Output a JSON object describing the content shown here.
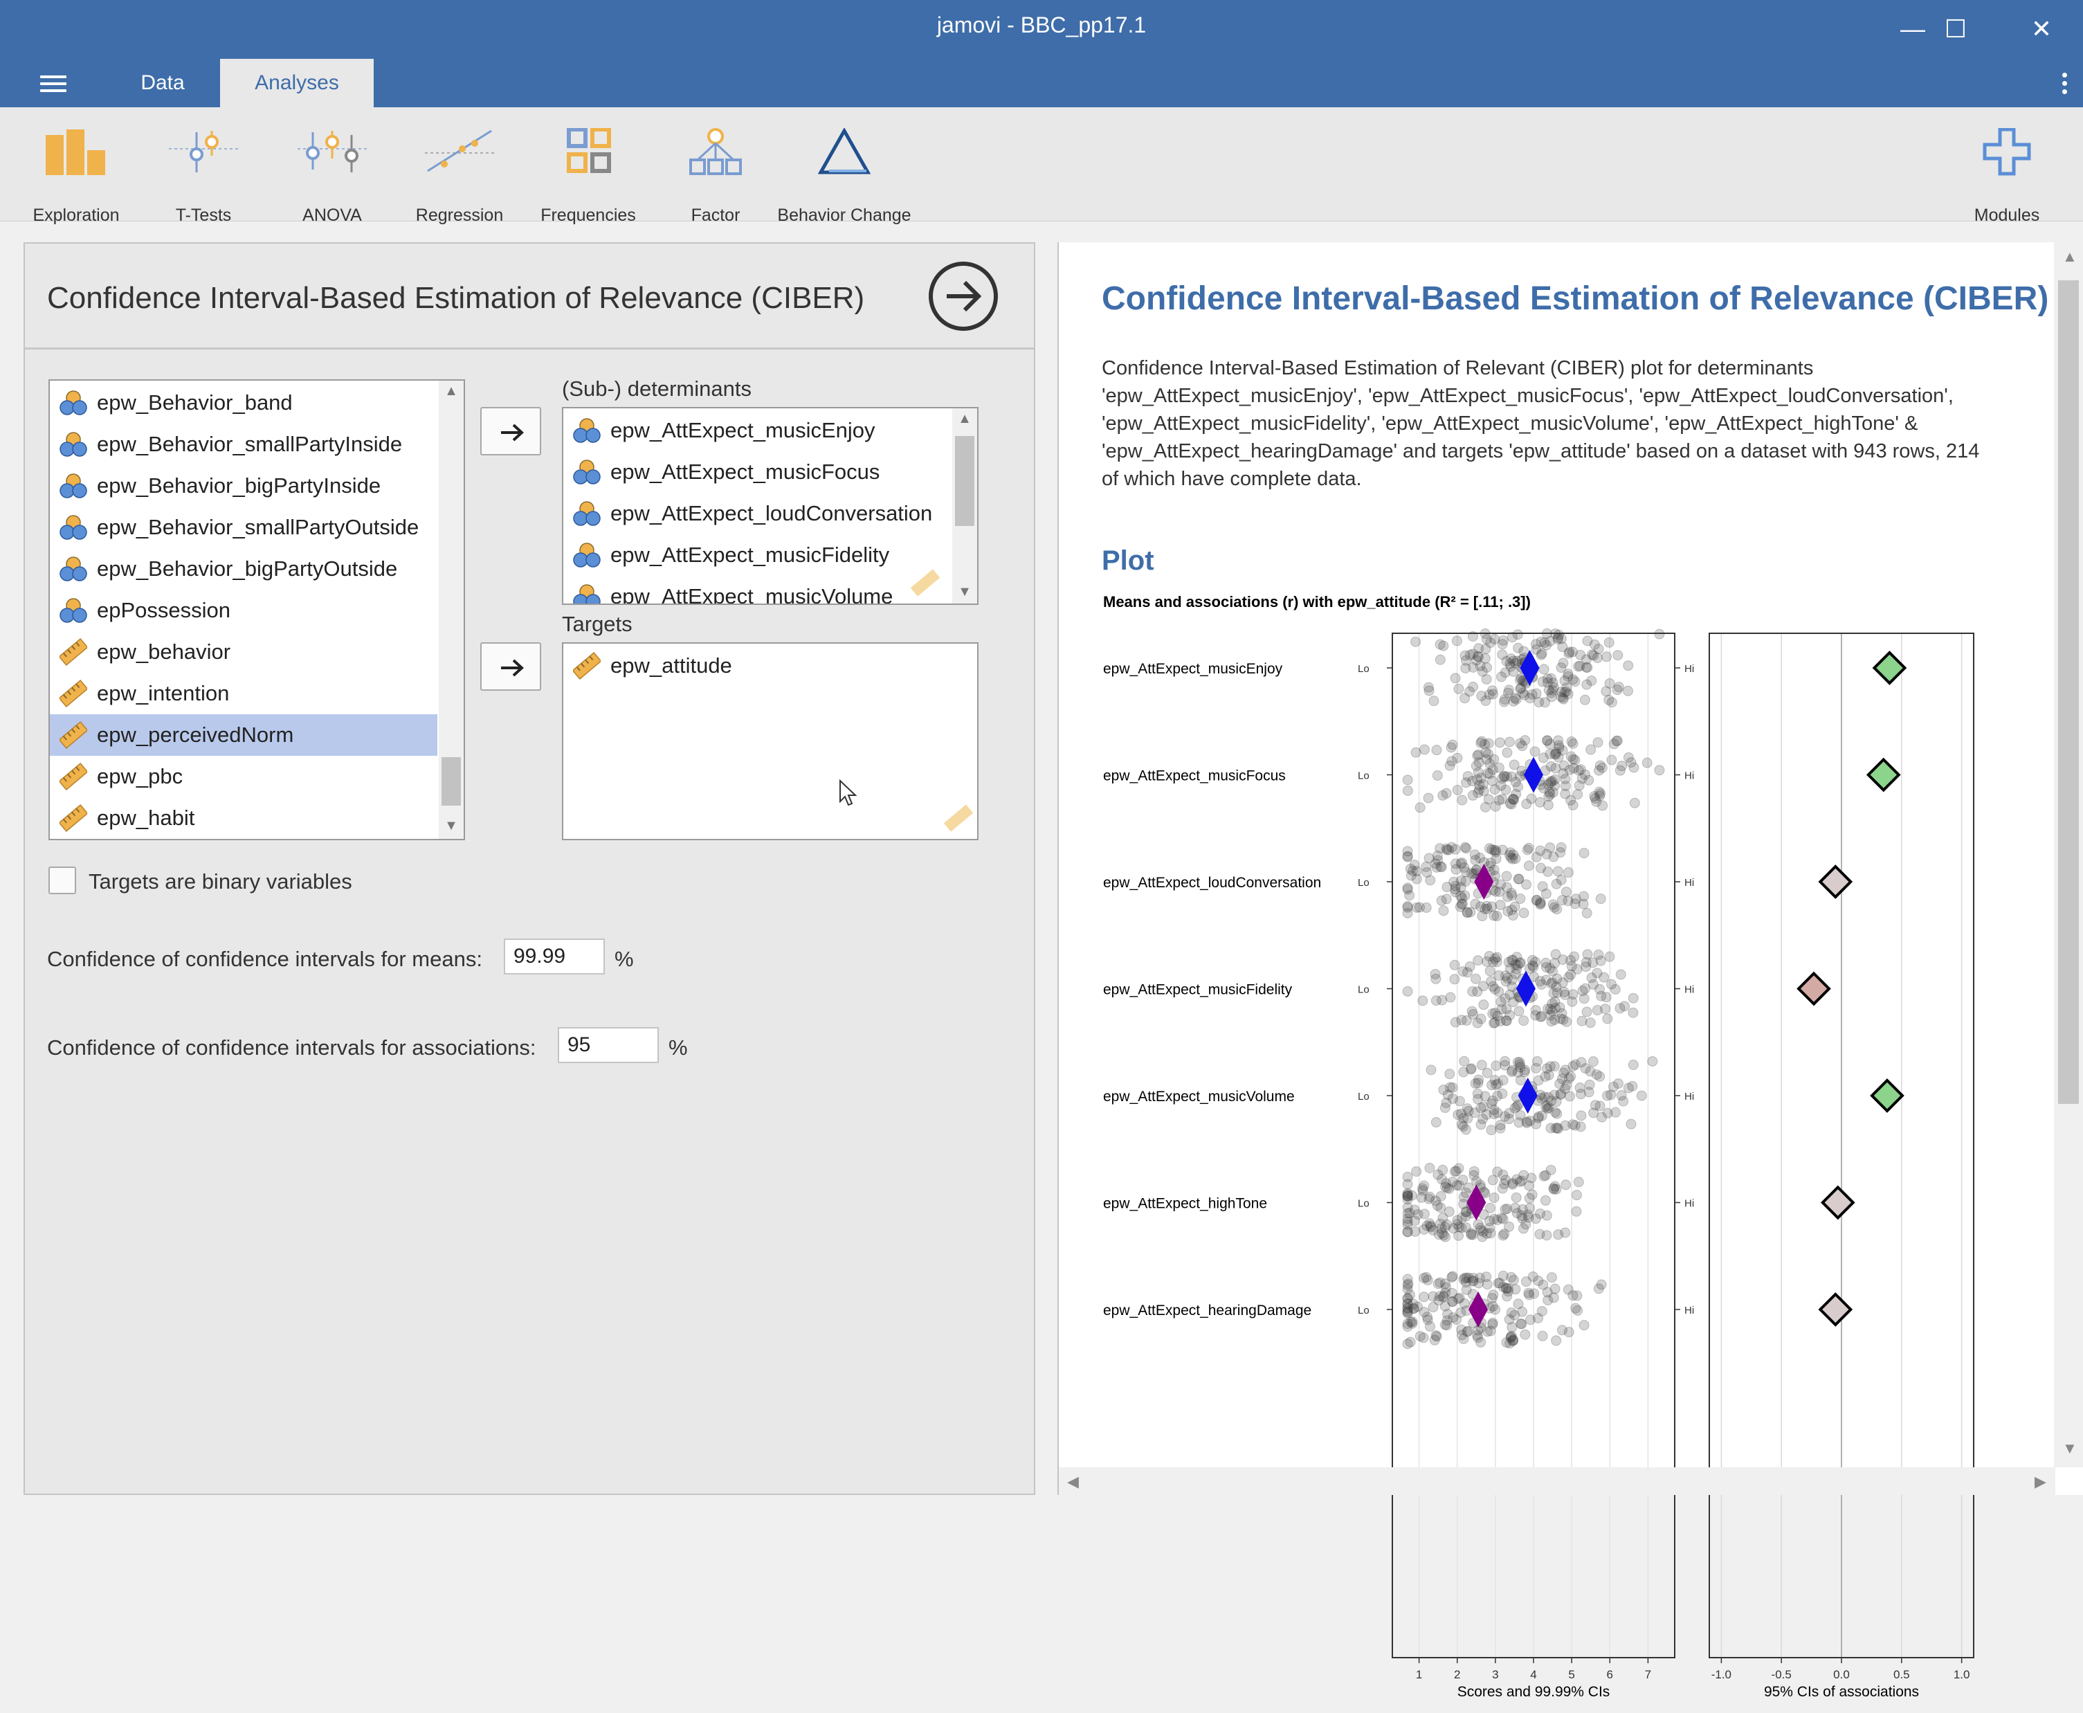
{
  "window": {
    "title": "jamovi - BBC_pp17.1",
    "minimize": "—",
    "maximize": "☐",
    "close": "✕"
  },
  "tabs": [
    {
      "label": "Data",
      "active": false
    },
    {
      "label": "Analyses",
      "active": true
    }
  ],
  "ribbon": [
    {
      "label": "Exploration",
      "icon": "exploration-icon"
    },
    {
      "label": "T-Tests",
      "icon": "t-tests-icon"
    },
    {
      "label": "ANOVA",
      "icon": "anova-icon"
    },
    {
      "label": "Regression",
      "icon": "regression-icon"
    },
    {
      "label": "Frequencies",
      "icon": "frequencies-icon"
    },
    {
      "label": "Factor",
      "icon": "factor-icon"
    },
    {
      "label": "Behavior Change",
      "icon": "behavior-change-icon"
    },
    {
      "label": "Modules",
      "icon": "modules-icon"
    }
  ],
  "analysis_panel": {
    "title": "Confidence Interval-Based Estimation of Relevance (CIBER)",
    "variables": [
      {
        "name": "epw_Behavior_band",
        "type": "nominal",
        "selected": false
      },
      {
        "name": "epw_Behavior_smallPartyInside",
        "type": "nominal",
        "selected": false
      },
      {
        "name": "epw_Behavior_bigPartyInside",
        "type": "nominal",
        "selected": false
      },
      {
        "name": "epw_Behavior_smallPartyOutside",
        "type": "nominal",
        "selected": false
      },
      {
        "name": "epw_Behavior_bigPartyOutside",
        "type": "nominal",
        "selected": false
      },
      {
        "name": "epPossession",
        "type": "nominal",
        "selected": false
      },
      {
        "name": "epw_behavior",
        "type": "continuous",
        "selected": false
      },
      {
        "name": "epw_intention",
        "type": "continuous",
        "selected": false
      },
      {
        "name": "epw_perceivedNorm",
        "type": "continuous",
        "selected": true
      },
      {
        "name": "epw_pbc",
        "type": "continuous",
        "selected": false
      },
      {
        "name": "epw_habit",
        "type": "continuous",
        "selected": false
      }
    ],
    "determinants_label": "(Sub-) determinants",
    "determinants": [
      "epw_AttExpect_musicEnjoy",
      "epw_AttExpect_musicFocus",
      "epw_AttExpect_loudConversation",
      "epw_AttExpect_musicFidelity",
      "epw_AttExpect_musicVolume"
    ],
    "targets_label": "Targets",
    "targets": [
      "epw_attitude"
    ],
    "binary_label": "Targets are binary variables",
    "binary_checked": false,
    "conf_means_label": "Confidence of confidence intervals for means:",
    "conf_means_value": "99.99",
    "conf_assoc_label": "Confidence of confidence intervals for associations:",
    "conf_assoc_value": "95",
    "percent": "%"
  },
  "results": {
    "title": "Confidence Interval-Based Estimation of Relevance (CIBER)",
    "description": "Confidence Interval-Based Estimation of Relevant (CIBER) plot for determinants 'epw_AttExpect_musicEnjoy', 'epw_AttExpect_musicFocus', 'epw_AttExpect_loudConversation', 'epw_AttExpect_musicFidelity', 'epw_AttExpect_musicVolume', 'epw_AttExpect_highTone' & 'epw_AttExpect_hearingDamage' and targets 'epw_attitude' based on a dataset with 943 rows, 214 of which have complete data.",
    "plot_heading": "Plot"
  },
  "chart_data": {
    "type": "scatter",
    "title": "Means and associations (r) with epw_attitude (R² = [.11; .3])",
    "categories": [
      "epw_AttExpect_musicEnjoy",
      "epw_AttExpect_musicFocus",
      "epw_AttExpect_loudConversation",
      "epw_AttExpect_musicFidelity",
      "epw_AttExpect_musicVolume",
      "epw_AttExpect_highTone",
      "epw_AttExpect_hearingDamage"
    ],
    "lo_label": "Lo",
    "hi_label": "Hi",
    "left_panel": {
      "xlabel": "Scores and 99.99% CIs",
      "xlim": [
        0.3,
        7.7
      ],
      "ticks": [
        1,
        2,
        3,
        4,
        5,
        6,
        7
      ],
      "tick_labels": [
        "1",
        "2",
        "3",
        "4",
        "5",
        "6",
        "7"
      ],
      "means": [
        3.9,
        4.0,
        2.7,
        3.8,
        3.85,
        2.5,
        2.55
      ],
      "mean_colors": [
        "#1010e8",
        "#1010e8",
        "#880088",
        "#1010e8",
        "#1010e8",
        "#880088",
        "#880088"
      ]
    },
    "right_panel": {
      "xlabel": "95% CIs of associations",
      "xlim": [
        -1.1,
        1.1
      ],
      "ticks": [
        -1.0,
        -0.5,
        0.0,
        0.5,
        1.0
      ],
      "tick_labels": [
        "-1.0",
        "-0.5",
        "0.0",
        "0.5",
        "1.0"
      ],
      "r": [
        0.4,
        0.35,
        -0.05,
        -0.23,
        0.38,
        -0.03,
        -0.05
      ],
      "r_colors": [
        "#8cd38c",
        "#8cd38c",
        "#d8cccc",
        "#d4aaa4",
        "#8cd38c",
        "#d8cccc",
        "#d8cccc"
      ]
    },
    "grid": true
  }
}
